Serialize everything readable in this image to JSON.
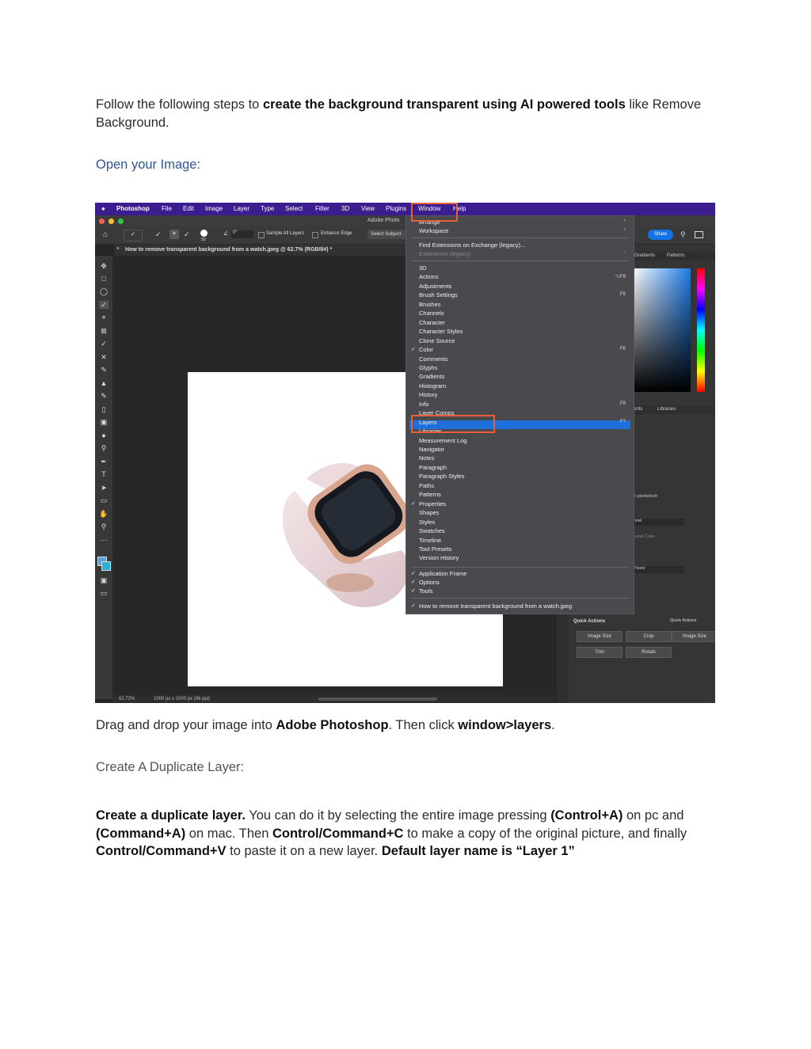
{
  "intro": {
    "pre": "Follow the following steps to ",
    "bold": "create the background transparent using AI powered tools",
    "post": " like Remove Background."
  },
  "heading_open": "Open your Image:",
  "screenshot": {
    "menubar": [
      "Photoshop",
      "File",
      "Edit",
      "Image",
      "Layer",
      "Type",
      "Select",
      "Filter",
      "3D",
      "View",
      "Plugins",
      "Window",
      "Help"
    ],
    "app_title": "Adobe Photo",
    "doc_tab": "How to remove transparent background from a watch.jpeg @ 62.7% (RGB/8#) *",
    "options": {
      "sample_all_layers": "Sample All Layers",
      "enhance_edge": "Enhance Edge",
      "select_subject": "Select Subject",
      "share": "Share",
      "brush_size": "50",
      "angle": "0°"
    },
    "panel_tabs_top": [
      "Gradients",
      "Patterns"
    ],
    "panel_tabs_mid": [
      "ents",
      "Libraries"
    ],
    "panel_values": [
      "6 pixels/inch",
      "nnel",
      "ound Color",
      "Pixels"
    ],
    "quick_actions_title": "Quick Actions",
    "quick_actions": [
      "Image Size",
      "Crop",
      "Trim",
      "Rotate"
    ],
    "status": {
      "zoom": "62.72%",
      "size": "1000 px x 1000 px (96 ppi)"
    },
    "menu": {
      "top_items": [
        "Arrange",
        "Workspace"
      ],
      "ext_items": [
        "Find Extensions on Exchange (legacy)...",
        "Extensions (legacy)"
      ],
      "items": [
        "3D",
        "Actions",
        "Adjustments",
        "Brush Settings",
        "Brushes",
        "Channels",
        "Character",
        "Character Styles",
        "Clone Source",
        "Color",
        "Comments",
        "Glyphs",
        "Gradients",
        "Histogram",
        "History",
        "Info",
        "Layer Comps",
        "Layers",
        "Libraries",
        "Measurement Log",
        "Navigator",
        "Notes",
        "Paragraph",
        "Paragraph Styles",
        "Paths",
        "Patterns",
        "Properties",
        "Shapes",
        "Styles",
        "Swatches",
        "Timeline",
        "Tool Presets",
        "Version History"
      ],
      "checked": [
        "Color",
        "Properties"
      ],
      "shortcuts": {
        "Actions": "⌥F9",
        "Brush Settings": "F5",
        "Color": "F6",
        "Info": "F8",
        "Layers": "F7"
      },
      "bottom_items": [
        "Application Frame",
        "Options",
        "Tools"
      ],
      "doc_item": "How to remove transparent background from a watch.jpeg"
    }
  },
  "caption": {
    "pre": "Drag and drop your image into ",
    "bold1": "Adobe Photoshop",
    "mid": ". Then click ",
    "bold2": "window>layers",
    "post": "."
  },
  "heading_dup": "Create A Duplicate Layer:",
  "dup": {
    "b1": "Create a duplicate layer.",
    "t1": " You can do it by selecting the entire image pressing ",
    "b2": "(Control+A)",
    "t2": " on pc and ",
    "b3": "(Command+A)",
    "t3": " on mac. Then ",
    "b4": "Control/Command+C",
    "t4": " to make a copy of the original picture, and finally ",
    "b5": "Control/Command+V",
    "t5": " to paste it on a new layer. ",
    "b6": "Default layer name is “Layer 1”"
  },
  "colors": {
    "menubar": "#3b1d8f",
    "highlight": "#1e6fd9",
    "callout": "#e8603a",
    "heading_blue": "#2f5496"
  }
}
